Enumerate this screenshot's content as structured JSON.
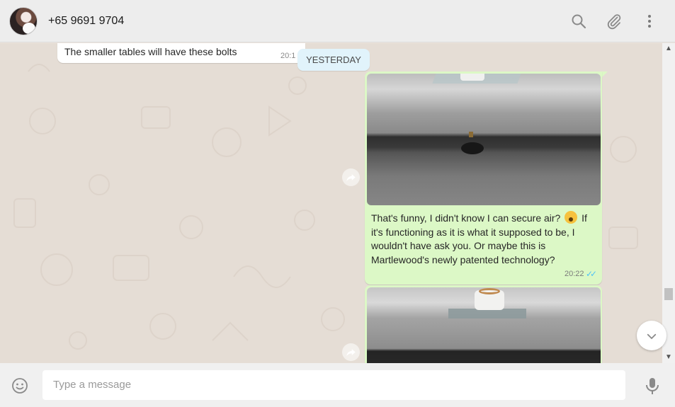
{
  "header": {
    "contact_name": "+65 9691 9704",
    "icons": [
      "search-icon",
      "attach-icon",
      "menu-icon"
    ]
  },
  "chat": {
    "incoming": {
      "text": "The smaller tables will have these bolts",
      "time": "20:1"
    },
    "date_divider": "YESTERDAY",
    "outgoing": [
      {
        "has_photo": true,
        "text_before_emoji": "That's funny, I didn't know I can secure air?",
        "text_after_emoji": " If it's functioning as it is what it supposed to be, I wouldn't have ask you. Or maybe this is Martlewood's newly patented technology?",
        "time": "20:22",
        "status": "read"
      },
      {
        "has_photo": true
      }
    ]
  },
  "footer": {
    "input_placeholder": "Type a message"
  },
  "colors": {
    "outgoing_bubble": "#dcf8c6",
    "incoming_bubble": "#ffffff",
    "date_chip": "#e1f3fb",
    "read_ticks": "#4fc3f7"
  }
}
